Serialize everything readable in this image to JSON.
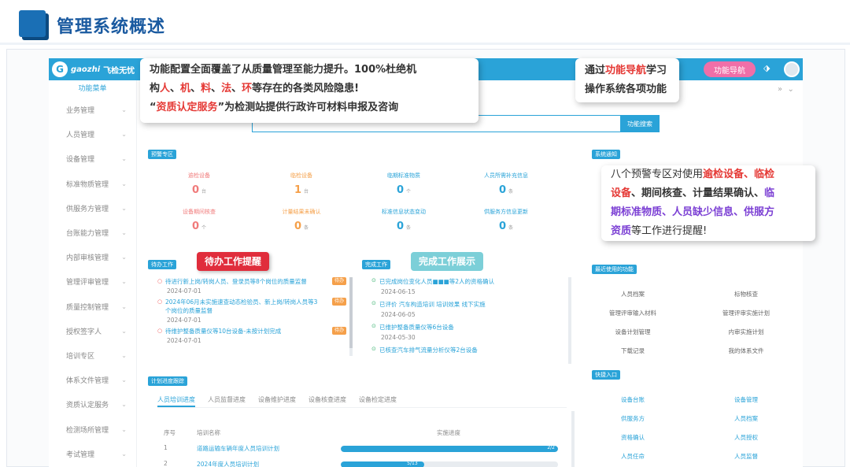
{
  "slide": {
    "title": "管理系统概述"
  },
  "app": {
    "logo_text": "gaozhi",
    "logo_sub": "飞检无忧",
    "nav_button": "功能导航",
    "search_button": "功能搜索"
  },
  "sidebar": {
    "title": "功能菜单",
    "items": [
      {
        "label": "业务管理"
      },
      {
        "label": "人员管理"
      },
      {
        "label": "设备管理"
      },
      {
        "label": "标准物质管理"
      },
      {
        "label": "供服务方管理"
      },
      {
        "label": "台账能力管理"
      },
      {
        "label": "内部审核管理"
      },
      {
        "label": "管理评审管理"
      },
      {
        "label": "质量控制管理"
      },
      {
        "label": "授权签字人"
      },
      {
        "label": "培训专区"
      },
      {
        "label": "体系文件管理"
      },
      {
        "label": "资质认定服务"
      },
      {
        "label": "检测场所管理"
      },
      {
        "label": "考试管理"
      }
    ]
  },
  "warnings": {
    "tag": "预警专区",
    "cells": [
      {
        "label": "逾检设备",
        "num": "0",
        "unit": "台",
        "color": "#f07a7a"
      },
      {
        "label": "临检设备",
        "num": "1",
        "unit": "台",
        "color": "#f5a04a"
      },
      {
        "label": "临期标准物质",
        "num": "0",
        "unit": "个",
        "color": "#2aa3d8"
      },
      {
        "label": "人员所需补充信息",
        "num": "0",
        "unit": "条",
        "color": "#2aa3d8"
      },
      {
        "label": "设备期间核查",
        "num": "0",
        "unit": "个",
        "color": "#f07a7a"
      },
      {
        "label": "计量结果未确认",
        "num": "0",
        "unit": "条",
        "color": "#f5a04a"
      },
      {
        "label": "标准信息状态变动",
        "num": "0",
        "unit": "条",
        "color": "#2aa3d8"
      },
      {
        "label": "供服务方信息更新",
        "num": "0",
        "unit": "条",
        "color": "#2aa3d8"
      }
    ]
  },
  "todo": {
    "tag": "待办工作",
    "items": [
      {
        "text": "待进行新上岗/转岗人员、登录员等8个岗位的质量监督",
        "date": "2024-07-01",
        "badge": "待办"
      },
      {
        "text": "2024年06月未实施速查动态检验员、新上岗/转岗人员等3个岗位的质量监督",
        "date": "2024-07-01",
        "badge": "待办"
      },
      {
        "text": "待维护整备质量仪等10台设备-未按计划完成",
        "date": "2024-07-01",
        "badge": "待办"
      }
    ]
  },
  "done": {
    "tag": "完成工作",
    "items": [
      {
        "text": "已完成岗位变化人员■■■等2人的资格确认",
        "date": "2024-06-15"
      },
      {
        "text": "已评价 汽车构造培训 培训效果 线下实施",
        "date": "2024-06-05"
      },
      {
        "text": "已维护整备质量仪等6台设备",
        "date": "2024-05-30"
      },
      {
        "text": "已核查汽车排气流量分析仪等2台设备",
        "date": ""
      }
    ]
  },
  "plan": {
    "tag": "计划进度跟踪",
    "tabs": [
      "人员培训进度",
      "人员监督进度",
      "设备维护进度",
      "设备核查进度",
      "设备检定进度"
    ],
    "columns": [
      "序号",
      "培训名称",
      "实施进度"
    ],
    "rows": [
      {
        "no": "1",
        "name": "道路运输车辆年度人员培训计划",
        "progress_label": "2/2",
        "progress": 1.0
      },
      {
        "no": "2",
        "name": "2024年度人员培训计划",
        "progress_label": "5/13",
        "progress": 0.385
      }
    ]
  },
  "right": {
    "notice_tag": "系统通知",
    "recent_tag": "最近使用的功能",
    "recent": [
      "人员档案",
      "标物核查",
      "管理评审输入材料",
      "管理评审实施计划",
      "设备计划管理",
      "内审实施计划",
      "下载记录",
      "我的体系文件"
    ],
    "quick_tag": "快捷入口",
    "quick": [
      "设备台账",
      "设备管理",
      "供服务方",
      "人员档案",
      "资格确认",
      "人员授权",
      "人员任命",
      "人员监督"
    ]
  },
  "callouts": {
    "top_line1_a": "功能配置全面覆盖了从质量管理至能力提升。100%杜绝机",
    "top_line2_a": "构",
    "top_line2_r1": "人",
    "top_line2_s1": "、",
    "top_line2_r2": "机",
    "top_line2_s2": "、",
    "top_line2_r3": "料",
    "top_line2_s3": "、",
    "top_line2_r4": "法",
    "top_line2_s4": "、",
    "top_line2_r5": "环",
    "top_line2_b": "等存在的各类风险隐患!",
    "top_line3_q1": "“",
    "top_line3_r": "资质认定服务",
    "top_line3_q2": "”为检测站提供行政许可材料申报及咨询",
    "nav_line1_a": "通过",
    "nav_line1_r": "功能导航",
    "nav_line1_b": "学习",
    "nav_line2": "操作系统各项功能",
    "warn_l1_a": "八个预警专区对使用",
    "warn_l1_r": "逾检设备、临检",
    "warn_l2_r": "设备",
    "warn_l2_b": "、期间核查、计量结果确认、",
    "warn_l2_p": "临",
    "warn_l3_p": "期标准物质、人员缺少信息、供服方",
    "warn_l4_p": "资质",
    "warn_l4_b": "等工作进行提醒!",
    "todo_pill": "待办工作提醒",
    "done_pill": "完成工作展示"
  }
}
